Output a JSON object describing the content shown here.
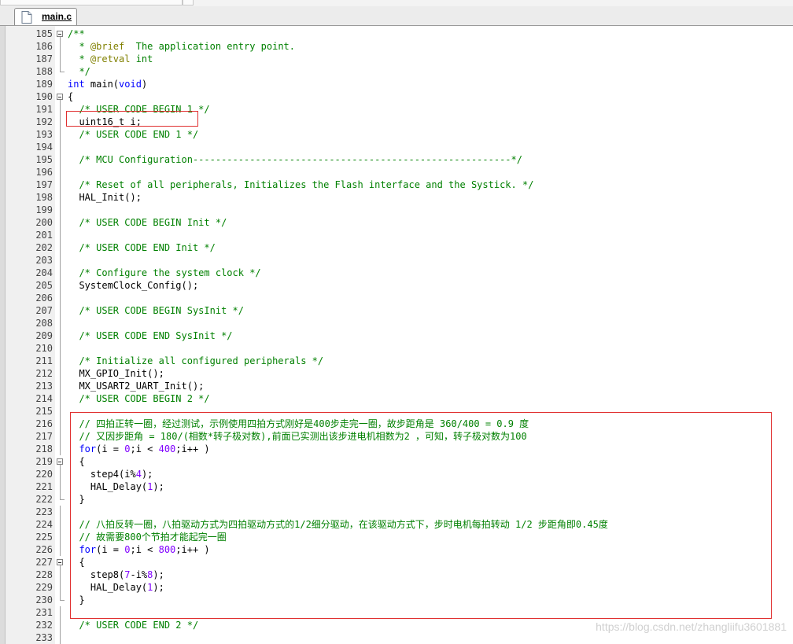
{
  "tab": {
    "label": "main.c",
    "icon": "file-icon"
  },
  "watermark": "https://blog.csdn.net/zhangliifu3601881",
  "lines": [
    {
      "n": "185",
      "fold": "start",
      "parts": [
        [
          "comment",
          "/**"
        ]
      ]
    },
    {
      "n": "186",
      "fold": "mid",
      "parts": [
        [
          "comment",
          "  * "
        ],
        [
          "tag",
          "@brief"
        ],
        [
          "comment",
          "  The application entry point."
        ]
      ]
    },
    {
      "n": "187",
      "fold": "mid",
      "parts": [
        [
          "comment",
          "  * "
        ],
        [
          "tag",
          "@retval"
        ],
        [
          "comment",
          " int"
        ]
      ]
    },
    {
      "n": "188",
      "fold": "end",
      "parts": [
        [
          "comment",
          "  */"
        ]
      ]
    },
    {
      "n": "189",
      "fold": "",
      "parts": [
        [
          "kw",
          "int"
        ],
        [
          "plain",
          " main("
        ],
        [
          "kw",
          "void"
        ],
        [
          "plain",
          ")"
        ]
      ]
    },
    {
      "n": "190",
      "fold": "start",
      "parts": [
        [
          "plain",
          "{"
        ]
      ]
    },
    {
      "n": "191",
      "fold": "mid",
      "parts": [
        [
          "comment",
          "  /* USER CODE BEGIN 1 */"
        ]
      ]
    },
    {
      "n": "192",
      "fold": "mid",
      "parts": [
        [
          "plain",
          "  uint16_t i;"
        ]
      ]
    },
    {
      "n": "193",
      "fold": "mid",
      "parts": [
        [
          "comment",
          "  /* USER CODE END 1 */"
        ]
      ]
    },
    {
      "n": "194",
      "fold": "mid",
      "parts": [
        [
          "plain",
          ""
        ]
      ]
    },
    {
      "n": "195",
      "fold": "mid",
      "parts": [
        [
          "comment",
          "  /* MCU Configuration--------------------------------------------------------*/"
        ]
      ]
    },
    {
      "n": "196",
      "fold": "mid",
      "parts": [
        [
          "plain",
          ""
        ]
      ]
    },
    {
      "n": "197",
      "fold": "mid",
      "parts": [
        [
          "comment",
          "  /* Reset of all peripherals, Initializes the Flash interface and the Systick. */"
        ]
      ]
    },
    {
      "n": "198",
      "fold": "mid",
      "parts": [
        [
          "plain",
          "  HAL_Init();"
        ]
      ]
    },
    {
      "n": "199",
      "fold": "mid",
      "parts": [
        [
          "plain",
          ""
        ]
      ]
    },
    {
      "n": "200",
      "fold": "mid",
      "parts": [
        [
          "comment",
          "  /* USER CODE BEGIN Init */"
        ]
      ]
    },
    {
      "n": "201",
      "fold": "mid",
      "parts": [
        [
          "plain",
          ""
        ]
      ]
    },
    {
      "n": "202",
      "fold": "mid",
      "parts": [
        [
          "comment",
          "  /* USER CODE END Init */"
        ]
      ]
    },
    {
      "n": "203",
      "fold": "mid",
      "parts": [
        [
          "plain",
          ""
        ]
      ]
    },
    {
      "n": "204",
      "fold": "mid",
      "parts": [
        [
          "comment",
          "  /* Configure the system clock */"
        ]
      ]
    },
    {
      "n": "205",
      "fold": "mid",
      "parts": [
        [
          "plain",
          "  SystemClock_Config();"
        ]
      ]
    },
    {
      "n": "206",
      "fold": "mid",
      "parts": [
        [
          "plain",
          ""
        ]
      ]
    },
    {
      "n": "207",
      "fold": "mid",
      "parts": [
        [
          "comment",
          "  /* USER CODE BEGIN SysInit */"
        ]
      ]
    },
    {
      "n": "208",
      "fold": "mid",
      "parts": [
        [
          "plain",
          ""
        ]
      ]
    },
    {
      "n": "209",
      "fold": "mid",
      "parts": [
        [
          "comment",
          "  /* USER CODE END SysInit */"
        ]
      ]
    },
    {
      "n": "210",
      "fold": "mid",
      "parts": [
        [
          "plain",
          ""
        ]
      ]
    },
    {
      "n": "211",
      "fold": "mid",
      "parts": [
        [
          "comment",
          "  /* Initialize all configured peripherals */"
        ]
      ]
    },
    {
      "n": "212",
      "fold": "mid",
      "parts": [
        [
          "plain",
          "  MX_GPIO_Init();"
        ]
      ]
    },
    {
      "n": "213",
      "fold": "mid",
      "parts": [
        [
          "plain",
          "  MX_USART2_UART_Init();"
        ]
      ]
    },
    {
      "n": "214",
      "fold": "mid",
      "parts": [
        [
          "comment",
          "  /* USER CODE BEGIN 2 */"
        ]
      ]
    },
    {
      "n": "215",
      "fold": "mid",
      "parts": [
        [
          "plain",
          ""
        ]
      ]
    },
    {
      "n": "216",
      "fold": "mid",
      "parts": [
        [
          "comment",
          "  // 四拍正转一圈，经过测试，示例使用四拍方式刚好是400步走完一圈，故步距角是 360/400 = 0.9 度"
        ]
      ]
    },
    {
      "n": "217",
      "fold": "mid",
      "parts": [
        [
          "comment",
          "  // 又因步距角 = 180/(相数*转子极对数),前面已实测出该步进电机相数为2 ，可知，转子极对数为100"
        ]
      ]
    },
    {
      "n": "218",
      "fold": "mid",
      "parts": [
        [
          "kw",
          "  for"
        ],
        [
          "plain",
          "(i = "
        ],
        [
          "num",
          "0"
        ],
        [
          "plain",
          ";i < "
        ],
        [
          "num",
          "400"
        ],
        [
          "plain",
          ";i++ )"
        ]
      ]
    },
    {
      "n": "219",
      "fold": "start",
      "parts": [
        [
          "plain",
          "  {"
        ]
      ]
    },
    {
      "n": "220",
      "fold": "mid",
      "parts": [
        [
          "plain",
          "    step4(i%"
        ],
        [
          "num",
          "4"
        ],
        [
          "plain",
          ");"
        ]
      ]
    },
    {
      "n": "221",
      "fold": "mid",
      "parts": [
        [
          "plain",
          "    HAL_Delay("
        ],
        [
          "num",
          "1"
        ],
        [
          "plain",
          ");"
        ]
      ]
    },
    {
      "n": "222",
      "fold": "end",
      "parts": [
        [
          "plain",
          "  }"
        ]
      ]
    },
    {
      "n": "223",
      "fold": "mid",
      "parts": [
        [
          "plain",
          ""
        ]
      ]
    },
    {
      "n": "224",
      "fold": "mid",
      "parts": [
        [
          "comment",
          "  // 八拍反转一圈，八拍驱动方式为四拍驱动方式的1/2细分驱动，在该驱动方式下，步时电机每拍转动 1/2 步距角即0.45度"
        ]
      ]
    },
    {
      "n": "225",
      "fold": "mid",
      "parts": [
        [
          "comment",
          "  // 故需要800个节拍才能起完一圈"
        ]
      ]
    },
    {
      "n": "226",
      "fold": "mid",
      "parts": [
        [
          "kw",
          "  for"
        ],
        [
          "plain",
          "(i = "
        ],
        [
          "num",
          "0"
        ],
        [
          "plain",
          ";i < "
        ],
        [
          "num",
          "800"
        ],
        [
          "plain",
          ";i++ )"
        ]
      ]
    },
    {
      "n": "227",
      "fold": "start",
      "parts": [
        [
          "plain",
          "  {"
        ]
      ]
    },
    {
      "n": "228",
      "fold": "mid",
      "parts": [
        [
          "plain",
          "    step8("
        ],
        [
          "num",
          "7"
        ],
        [
          "plain",
          "-i%"
        ],
        [
          "num",
          "8"
        ],
        [
          "plain",
          ");"
        ]
      ]
    },
    {
      "n": "229",
      "fold": "mid",
      "parts": [
        [
          "plain",
          "    HAL_Delay("
        ],
        [
          "num",
          "1"
        ],
        [
          "plain",
          ");"
        ]
      ]
    },
    {
      "n": "230",
      "fold": "end",
      "parts": [
        [
          "plain",
          "  }"
        ]
      ]
    },
    {
      "n": "231",
      "fold": "mid",
      "parts": [
        [
          "plain",
          ""
        ]
      ]
    },
    {
      "n": "232",
      "fold": "mid",
      "parts": [
        [
          "comment",
          "  /* USER CODE END 2 */"
        ]
      ]
    },
    {
      "n": "233",
      "fold": "mid",
      "parts": [
        [
          "plain",
          ""
        ]
      ]
    }
  ]
}
